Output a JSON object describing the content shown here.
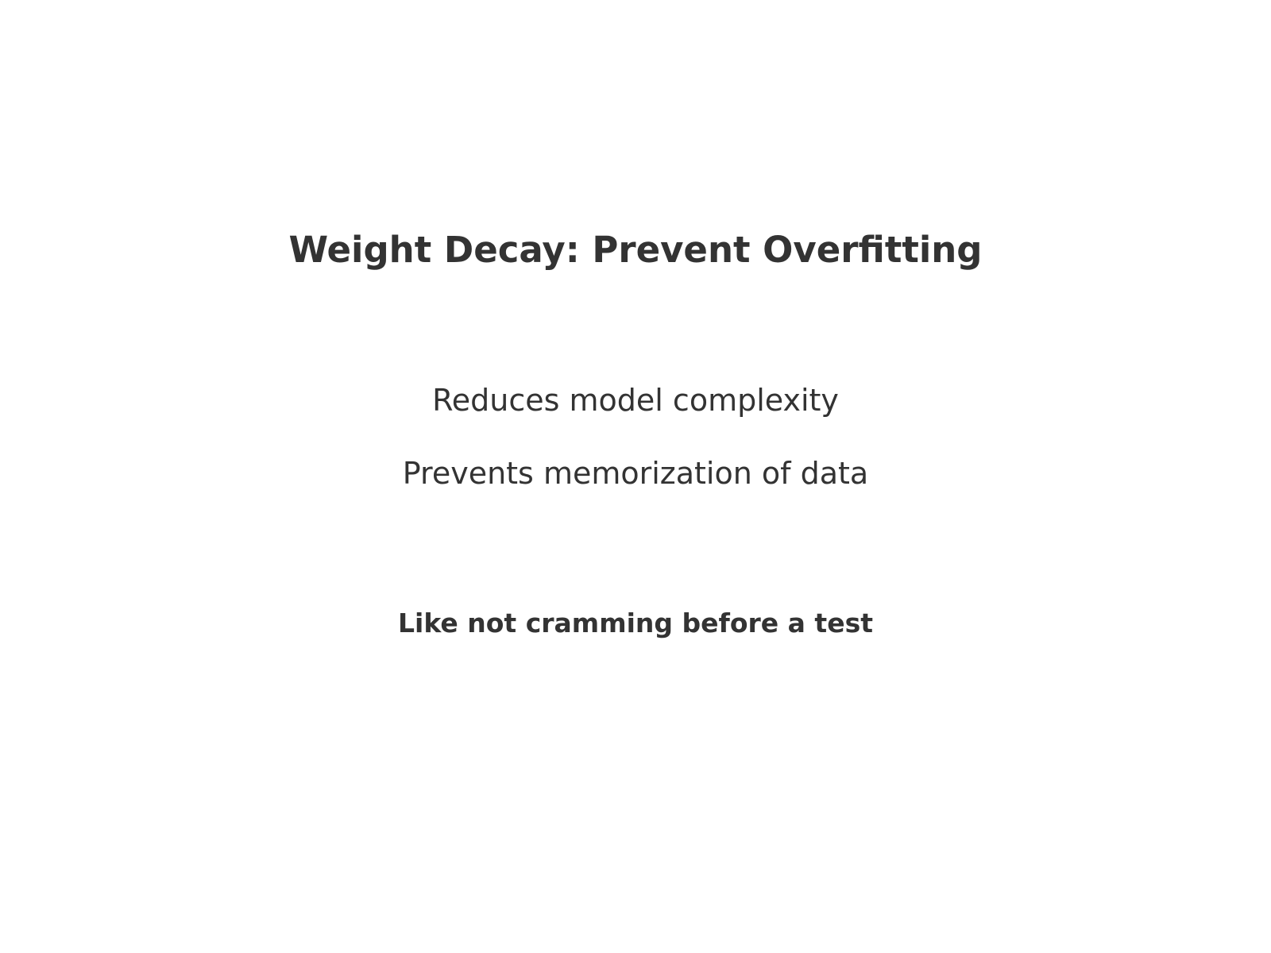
{
  "slide": {
    "title": "Weight Decay: Prevent Overfitting",
    "points": [
      "Reduces model complexity",
      "Prevents memorization of data"
    ],
    "analogy": "Like not cramming before a test"
  },
  "colors": {
    "text": "#333333",
    "background": "#ffffff"
  }
}
